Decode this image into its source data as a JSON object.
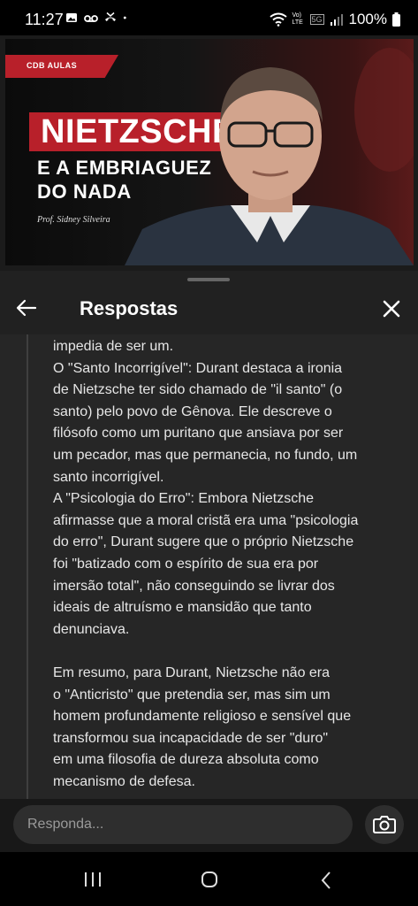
{
  "status_bar": {
    "time": "11:27",
    "battery": "100%",
    "network": "Vo) LTE",
    "network_5g": "5G"
  },
  "video": {
    "brand": "CDB AULAS",
    "title_main": "NIETZSCHE",
    "title_line2": "E A EMBRIAGUEZ",
    "title_line3": "DO NADA",
    "presenter": "Prof. Sidney Silveira"
  },
  "header": {
    "title": "Respostas"
  },
  "reply": {
    "lines": [
      "impedia de ser um.",
      "O \"Santo Incorrigível\": Durant destaca a ironia",
      "de Nietzsche ter sido chamado de \"il santo\" (o",
      "santo) pelo povo de Gênova. Ele descreve o",
      "filósofo como um puritano que ansiava por ser",
      "um pecador, mas que permanecia, no fundo, um",
      "santo incorrigível.",
      "A \"Psicologia do Erro\": Embora Nietzsche",
      "afirmasse que a moral cristã era uma \"psicologia",
      "do erro\", Durant sugere que o próprio Nietzsche",
      "foi \"batizado com o espírito de sua era por",
      "imersão total\", não conseguindo se livrar dos",
      "ideais de altruísmo e mansidão que tanto",
      "denunciava.",
      "",
      "Em resumo, para Durant, Nietzsche não era",
      "o \"Anticristo\" que pretendia ser, mas sim um",
      "homem profundamente religioso e sensível que",
      "transformou sua incapacidade de ser \"duro\"",
      "em uma filosofia de dureza absoluta como",
      "mecanismo de defesa."
    ]
  },
  "compose": {
    "placeholder": "Responda..."
  },
  "icons": {
    "back": "arrow-left-icon",
    "close": "close-icon",
    "camera": "camera-icon"
  }
}
